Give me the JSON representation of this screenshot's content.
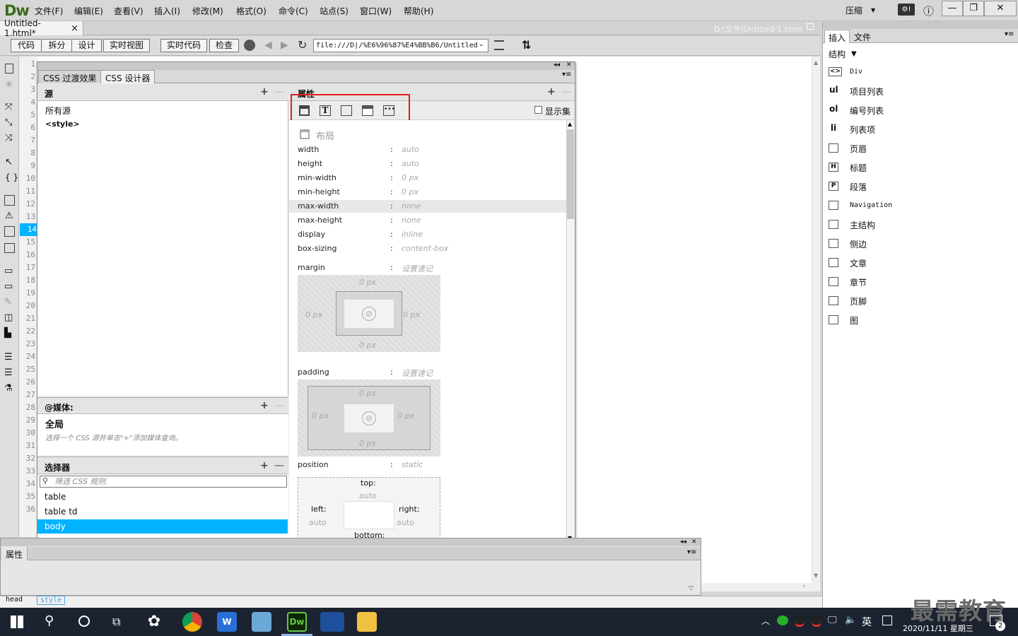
{
  "app": {
    "logo": "Dw"
  },
  "menu": [
    "文件(F)",
    "编辑(E)",
    "查看(V)",
    "插入(I)",
    "修改(M)",
    "格式(O)",
    "命令(C)",
    "站点(S)",
    "窗口(W)",
    "帮助(H)"
  ],
  "layout_mode": "压缩",
  "window_controls": {
    "minimize": "—",
    "restore": "❐",
    "close": "✕",
    "help": "ⓘ"
  },
  "document": {
    "tab": "Untitled-1.html*",
    "tab_close": "×",
    "path": "D:\\文件\\Untitled-1.html"
  },
  "toolbar": {
    "code": "代码",
    "split": "拆分",
    "design": "设计",
    "live_view": "实时视图",
    "live_code": "实时代码",
    "inspect": "检查",
    "url": "file:///D|/%E6%96%87%E4%BB%B6/Untitled"
  },
  "line_numbers": [
    "1",
    "2",
    "3",
    "4",
    "5",
    "6",
    "7",
    "8",
    "9",
    "10",
    "11",
    "12",
    "13",
    "14",
    "15",
    "16",
    "17",
    "18",
    "19",
    "20",
    "21",
    "22",
    "23",
    "24",
    "25",
    "26",
    "27",
    "28",
    "29",
    "30",
    "31",
    "32",
    "33",
    "34",
    "35",
    "36"
  ],
  "active_line": "14",
  "css_panel": {
    "tabs": [
      "CSS 过渡效果",
      "CSS 设计器"
    ],
    "sources": {
      "header": "源",
      "items": [
        "所有源",
        "<style>"
      ]
    },
    "media": {
      "header": "@媒体:",
      "global": "全局",
      "hint": "选择一个 CSS 源并单击\"+\"添加媒体查询。"
    },
    "selectors": {
      "header": "选择器",
      "filter_placeholder": "筛选 CSS 规则",
      "items": [
        "table",
        "table td",
        "body"
      ],
      "selected": "body"
    },
    "properties": {
      "header": "属性",
      "show_set": "显示集",
      "section": "布局",
      "rows": [
        {
          "name": "width",
          "value": "auto"
        },
        {
          "name": "height",
          "value": "auto"
        },
        {
          "name": "min-width",
          "value": "0 px"
        },
        {
          "name": "min-height",
          "value": "0 px"
        },
        {
          "name": "max-width",
          "value": "none"
        },
        {
          "name": "max-height",
          "value": "none"
        },
        {
          "name": "display",
          "value": "inline"
        },
        {
          "name": "box-sizing",
          "value": "content-box"
        }
      ],
      "margin": {
        "label": "margin",
        "shorthand": "设置速记",
        "top": "0 px",
        "right": "0 px",
        "bottom": "0 px",
        "left": "0 px"
      },
      "padding": {
        "label": "padding",
        "shorthand": "设置速记",
        "top": "0 px",
        "right": "0 px",
        "bottom": "0 px",
        "left": "0 px"
      },
      "position": {
        "label": "position",
        "value": "static",
        "top": "top:",
        "top_v": "auto",
        "left": "left:",
        "left_v": "auto",
        "right": "right:",
        "right_v": "auto",
        "bottom": "bottom:"
      }
    }
  },
  "attr_panel": {
    "title": "属性"
  },
  "status": {
    "tag1": "head",
    "tag2": "style"
  },
  "insert_panel": {
    "tabs": [
      "插入",
      "文件"
    ],
    "category": "结构",
    "items": [
      {
        "icon": "<>",
        "label": "Div"
      },
      {
        "icon": "ul",
        "label": "项目列表"
      },
      {
        "icon": "ol",
        "label": "编号列表"
      },
      {
        "icon": "li",
        "label": "列表项"
      },
      {
        "icon": "",
        "label": "页眉"
      },
      {
        "icon": "H",
        "label": "标题"
      },
      {
        "icon": "P",
        "label": "段落"
      },
      {
        "icon": "",
        "label": "Navigation"
      },
      {
        "icon": "",
        "label": "主结构"
      },
      {
        "icon": "",
        "label": "侧边"
      },
      {
        "icon": "",
        "label": "文章"
      },
      {
        "icon": "",
        "label": "章节"
      },
      {
        "icon": "",
        "label": "页脚"
      },
      {
        "icon": "",
        "label": "图"
      }
    ]
  },
  "taskbar": {
    "ime": "英",
    "datetime": "2020/11/11 星期三",
    "badge": "2",
    "watermark": "最需教育"
  },
  "colors": {
    "selection": "#00b2ff",
    "highlight_box": "#e02020",
    "taskbar": "#1c2330"
  }
}
